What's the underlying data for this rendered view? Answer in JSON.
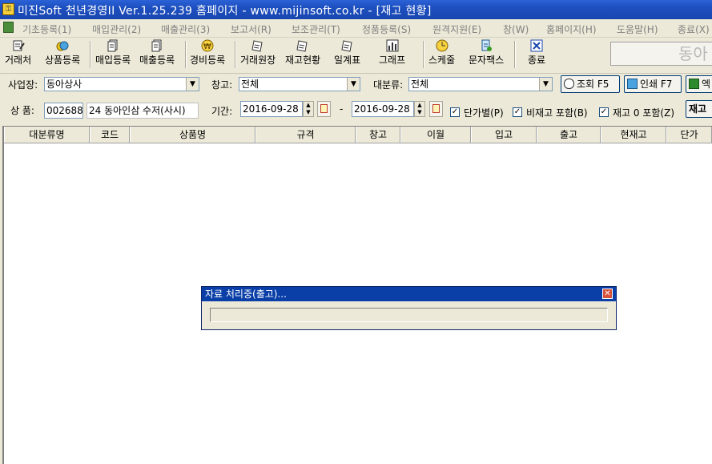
{
  "window": {
    "title": "미진Soft 천년경영II Ver.1.25.239        홈페이지 - www.mijinsoft.co.kr - [재고 현황]"
  },
  "menu": [
    "기초등록(1)",
    "매입관리(2)",
    "매출관리(3)",
    "보고서(R)",
    "보조관리(T)",
    "정품등록(S)",
    "원격지원(E)",
    "창(W)",
    "홈페이지(H)",
    "도움말(H)",
    "종료(X)"
  ],
  "toolbar": [
    "거래처",
    "상품등록",
    "매입등록",
    "매출등록",
    "경비등록",
    "거래원장",
    "재고현황",
    "일계표",
    "그래프",
    "스케줄",
    "문자팩스",
    "종료"
  ],
  "brand": "동아",
  "filters": {
    "site_label": "사업장:",
    "site_value": "동아상사",
    "warehouse_label": "창고:",
    "warehouse_value": "전체",
    "category_label": "대분류:",
    "category_value": "전체",
    "search_button": "조회 F5",
    "print_button": "인쇄 F7",
    "excel_button": "엑"
  },
  "product": {
    "label": "상 품:",
    "code": "002688",
    "name": "24 동아인삼 수저(사시)",
    "period_label": "기간:",
    "date_from": "2016-09-28",
    "date_to": "2016-09-28",
    "dash": "-",
    "chk_unit": "단가별(P)",
    "chk_nonstock": "비재고 포함(B)",
    "chk_zero": "재고 0 포함(Z)",
    "stock_button": "재고"
  },
  "checkmark": "✓",
  "table": {
    "columns": [
      "대분류명",
      "코드",
      "상품명",
      "규격",
      "창고",
      "이월",
      "입고",
      "출고",
      "현재고",
      "단가"
    ]
  },
  "dialog": {
    "title": "자료 처리중(출고)...",
    "progress": 0
  },
  "colors": {
    "titlebar": "#1d4fbf",
    "dialog_title": "#0a3fa8",
    "window_bg": "#ece9d8"
  }
}
